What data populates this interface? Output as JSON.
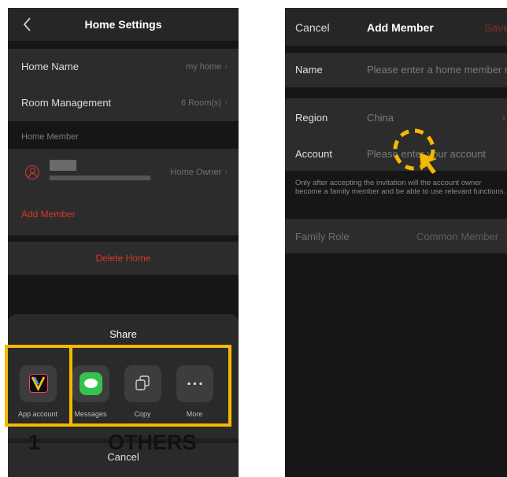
{
  "left_screen": {
    "title": "Home Settings",
    "home_name_label": "Home Name",
    "home_name_value": "my home",
    "room_mgmt_label": "Room Management",
    "room_mgmt_value": "6 Room(s)",
    "home_member_section": "Home Member",
    "member_role": "Home Owner",
    "add_member_label": "Add Member",
    "delete_home_label": "Delete Home",
    "share_sheet": {
      "title": "Share",
      "items": [
        {
          "label": "App account",
          "icon": "app-logo-icon"
        },
        {
          "label": "Messages",
          "icon": "messages-icon"
        },
        {
          "label": "Copy",
          "icon": "copy-icon"
        },
        {
          "label": "More",
          "icon": "more-icon"
        }
      ],
      "cancel_label": "Cancel"
    }
  },
  "annotations": {
    "label_1": "1",
    "label_others": "OTHERS",
    "box_color": "#f6b800"
  },
  "right_screen": {
    "cancel_label": "Cancel",
    "title": "Add Member",
    "save_label": "Save",
    "name_label": "Name",
    "name_placeholder": "Please enter a home member name",
    "region_label": "Region",
    "region_value": "China",
    "account_label": "Account",
    "account_placeholder": "Please enter your account",
    "note": "Only after accepting the invitation will the account owner become a family member and be able to use relevant functions.",
    "family_role_label": "Family Role",
    "family_role_value": "Common Member"
  },
  "colors": {
    "accent_red": "#d9362a",
    "background": "#161616",
    "row_bg": "#2c2c2c"
  }
}
